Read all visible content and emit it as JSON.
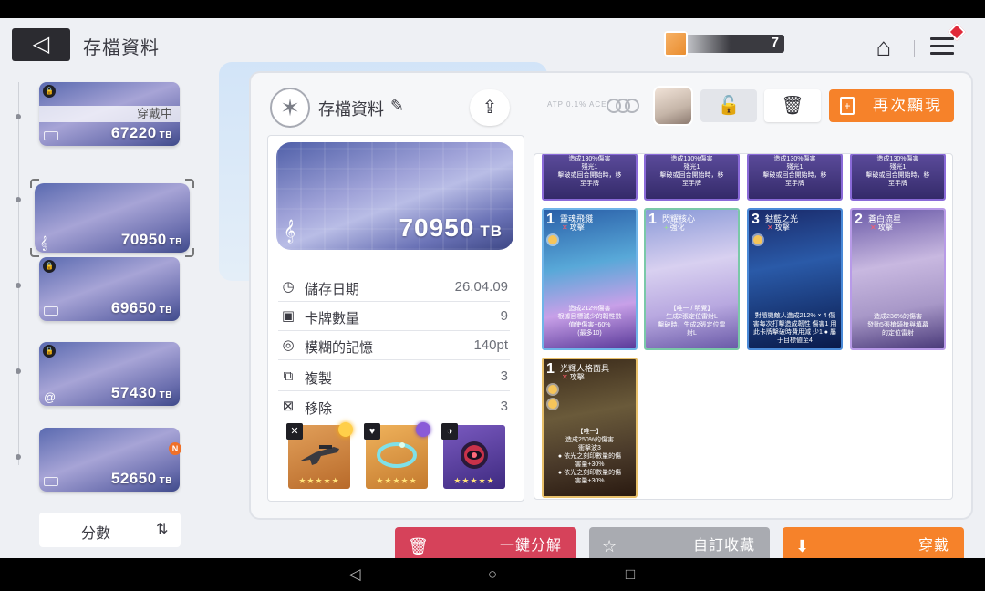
{
  "header": {
    "back_icon": "◁",
    "title": "存檔資料",
    "currency_value": "7",
    "home_icon": "⌂"
  },
  "slots": [
    {
      "capacity": "67220",
      "unit": "TB",
      "locked": true,
      "note": "穿戴中"
    },
    {
      "capacity": "70950",
      "unit": "TB",
      "locked": false,
      "selected": true
    },
    {
      "capacity": "69650",
      "unit": "TB",
      "locked": true
    },
    {
      "capacity": "57430",
      "unit": "TB",
      "locked": true
    },
    {
      "capacity": "52650",
      "unit": "TB",
      "locked": false,
      "badge": "N"
    }
  ],
  "sort": {
    "label": "分數",
    "icon": "⇅"
  },
  "panel": {
    "title": "存檔資料",
    "edit_icon": "✎",
    "share_icon": "⇪",
    "ghost_text": "ATP 0.1% ACE.",
    "reshow_label": "再次顯現",
    "reshow_icon": "+"
  },
  "disk": {
    "capacity": "70950",
    "unit": "TB",
    "clef": "𝄞"
  },
  "info_rows": [
    {
      "icon": "◷",
      "label": "儲存日期",
      "value": "26.04.09"
    },
    {
      "icon": "▣",
      "label": "卡牌數量",
      "value": "9"
    },
    {
      "icon": "◎",
      "label": "模糊的記憶",
      "value": "140pt"
    },
    {
      "icon": "⧉",
      "label": "複製",
      "value": "3"
    },
    {
      "icon": "⊠",
      "label": "移除",
      "value": "3"
    }
  ],
  "equipment": [
    {
      "slot": "✕",
      "stars": "★★★★★",
      "color": "#c9802a"
    },
    {
      "slot": "♥",
      "stars": "★★★★★",
      "color": "#d89a3e"
    },
    {
      "slot": "◑",
      "stars": "★★★★★",
      "color": "#6a4fae"
    }
  ],
  "top_cards": [
    {
      "desc": "造成130%傷害\n殘光1\n擊破或回合開始時，移\n至手牌"
    },
    {
      "desc": "造成130%傷害\n殘光1\n擊破或回合開始時，移\n至手牌"
    },
    {
      "desc": "造成130%傷害\n殘光1\n擊破或回合開始時，移\n至手牌"
    },
    {
      "desc": "造成130%傷害\n殘光1\n擊破或回合開始時，移\n至手牌"
    }
  ],
  "cards": [
    {
      "cost": "1",
      "name": "靈魂飛濺",
      "type": "攻擊",
      "desc": "造成212%傷害\n根據目標減少的韌性數\n值使傷害+60%\n(最多10)",
      "bg": "#3a6fb8"
    },
    {
      "cost": "1",
      "name": "閃耀核心",
      "type": "強化",
      "desc": "【唯一 / 明覺】\n生成2張定位雷射L\n擊破時，生成2張定位雷\n射L",
      "bg": "#7a8cc8"
    },
    {
      "cost": "3",
      "name": "鈷藍之光",
      "type": "攻擊",
      "desc": "對隨機敵人造成212% ×\n4\n傷害每次打擊造成韌性\n傷害1\n用此卡牌擊破時費用減\n少1\n● 屬于目標値至4",
      "bg": "#1f3f86"
    },
    {
      "cost": "2",
      "name": "蒼白流星",
      "type": "攻擊",
      "desc": "造成236%的傷害\n發動5張槍騎槍與填幕\n的定位雷射",
      "bg": "#8a7ab8"
    },
    {
      "cost": "1",
      "name": "光輝人格面具",
      "type": "攻擊",
      "desc": "【唯一】\n造成250%的傷害\n衝擊波3\n● 依光之刻印數量的傷\n害量+30%\n● 依光之刻印數量的傷\n害量+30%",
      "bg": "#5a4a2a"
    }
  ],
  "actions": {
    "dismantle": {
      "icon": "🗑",
      "label": "一鍵分解"
    },
    "favorite": {
      "icon": "☆",
      "label": "自訂收藏"
    },
    "wear": {
      "icon": "⬇",
      "label": "穿戴"
    }
  },
  "navbar": {
    "back": "◁",
    "home": "○",
    "recent": "□"
  }
}
